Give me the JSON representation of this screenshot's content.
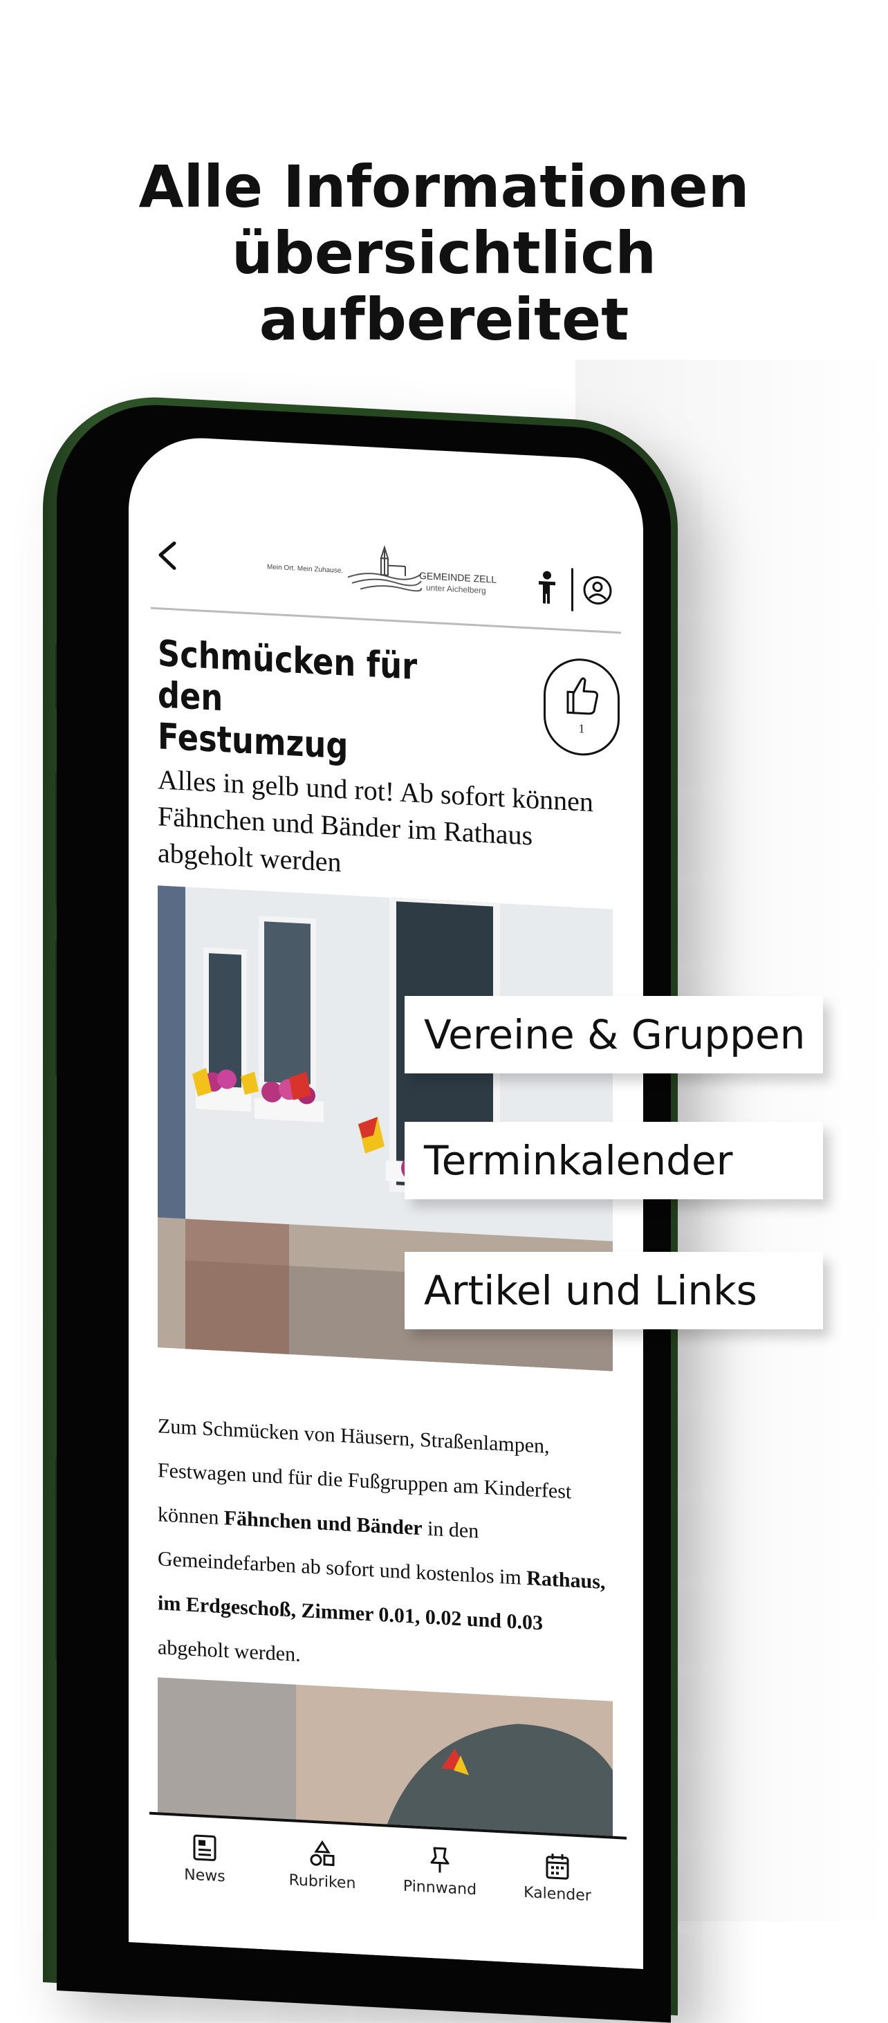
{
  "headline": {
    "line1": "Alle Informationen",
    "line2": "übersichtlich",
    "line3": "aufbereitet"
  },
  "header": {
    "logo_tagline": "Mein Ort. Mein Zuhause.",
    "logo_name": "GEMEINDE ZELL",
    "logo_sub": "unter Aichelberg"
  },
  "article": {
    "title_line1": "Schmücken für den",
    "title_line2": "Festumzug",
    "like_count": "1",
    "lead": "Alles in gelb und rot! Ab sofort können Fähnchen und Bänder im Rathaus abgeholt werden",
    "body": {
      "p1": "Zum Schmücken von Häusern, Straßenlampen, Festwagen und für die Fußgruppen am Kinderfest können ",
      "b1": "Fähnchen und Bänder",
      "p2": " in den Gemeindefarben ab sofort und kostenlos im ",
      "b2": "Rathaus, im Erdgeschoß, Zimmer 0.01, 0.02 und 0.03",
      "p3": " abgeholt werden."
    }
  },
  "tabs": [
    {
      "label": "News",
      "icon": "newspaper-icon"
    },
    {
      "label": "Rubriken",
      "icon": "categories-icon"
    },
    {
      "label": "Pinnwand",
      "icon": "pin-icon"
    },
    {
      "label": "Kalender",
      "icon": "calendar-icon"
    }
  ],
  "callouts": {
    "c1": "Vereine & Gruppen",
    "c2": "Terminkalender",
    "c3": "Artikel und Links"
  },
  "colors": {
    "phone_green": "#2f5429",
    "flag_yellow": "#f2c21a",
    "flag_red": "#d9342b"
  }
}
